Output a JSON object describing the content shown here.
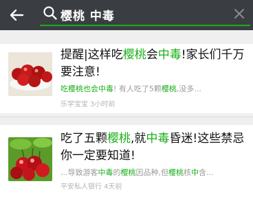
{
  "search": {
    "query": "樱桃 中毒"
  },
  "colors": {
    "highlight": "#1aad19",
    "topbar": "#3a3d42"
  },
  "results": [
    {
      "title_parts": [
        "提醒|这样吃",
        "樱桃",
        "会",
        "中毒",
        "!家长们千万要注意!"
      ],
      "snippet_parts": [
        "吃",
        "樱桃",
        "也会",
        "中毒",
        "! 有人吃了5颗",
        "樱桃",
        ",没多..."
      ],
      "source": "乐学宝宝 3小时前",
      "thumbnail": "cherries-bowl-image"
    },
    {
      "title_parts": [
        "吃了五颗",
        "樱桃",
        ",就",
        "中毒",
        "昏迷!这些禁忌你一定要知道!"
      ],
      "snippet_parts": [
        "...导致游客",
        "中毒",
        "的",
        "樱桃",
        "因品种,但",
        "樱桃",
        "核",
        "中",
        "含..."
      ],
      "source": "平安私人银行 4天前",
      "thumbnail": "cherries-cluster-image"
    }
  ]
}
